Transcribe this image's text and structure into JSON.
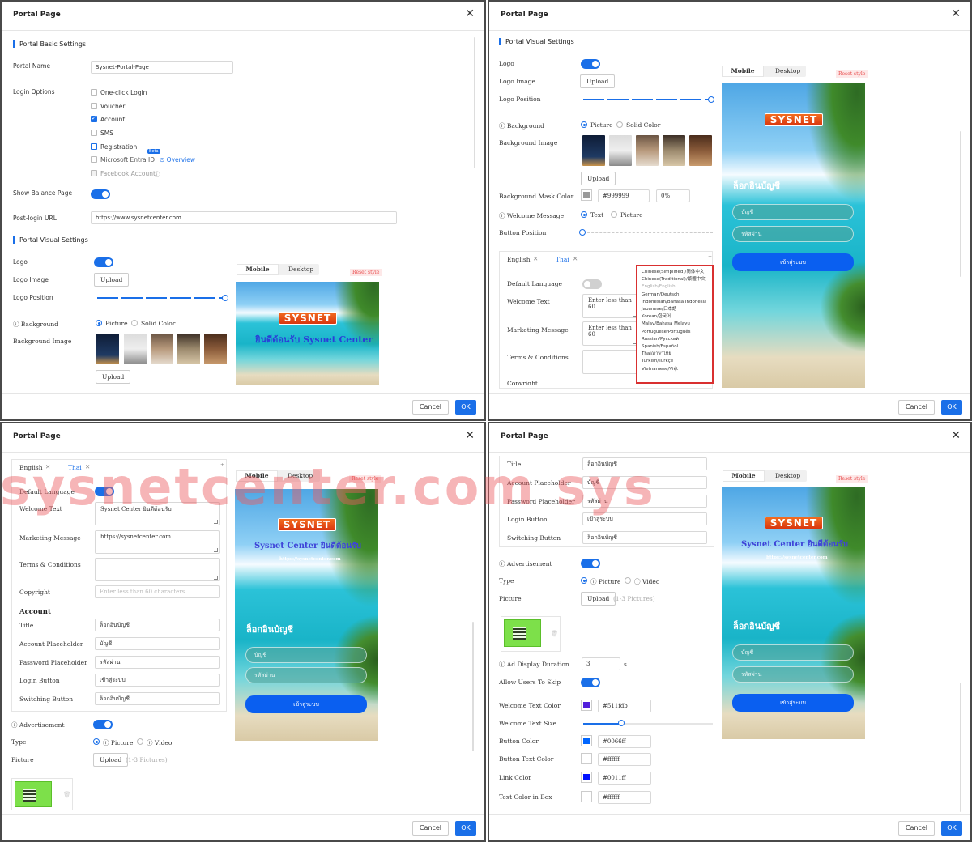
{
  "dialog_title": "Portal Page",
  "close_glyph": "✕",
  "cancel": "Cancel",
  "ok": "OK",
  "basic": {
    "section": "Portal Basic Settings",
    "portal_name_label": "Portal Name",
    "portal_name_value": "Sysnet-Portal-Page",
    "login_options_label": "Login Options",
    "options": [
      "One-click Login",
      "Voucher",
      "Account",
      "SMS",
      "Registration",
      "Microsoft Entra ID",
      "Facebook Account"
    ],
    "beta": "Beta",
    "overview": "Overview",
    "show_balance_label": "Show Balance Page",
    "post_login_label": "Post-login URL",
    "post_login_value": "https://www.sysnetcenter.com"
  },
  "visual": {
    "section": "Portal Visual Settings",
    "logo": "Logo",
    "logo_image": "Logo Image",
    "logo_position": "Logo Position",
    "background": "Background",
    "picture": "Picture",
    "solid_color": "Solid Color",
    "background_image": "Background Image",
    "upload": "Upload",
    "mask_color_label": "Background Mask Color",
    "mask_color": "#999999",
    "mask_opacity": "0%",
    "welcome_message": "Welcome Message",
    "text": "Text",
    "button_position": "Button Position",
    "mobile": "Mobile",
    "desktop": "Desktop",
    "reset_style": "Reset style"
  },
  "preview": {
    "logo": "SYSNET",
    "welcome_p1": "ยินดีต้อนรับ Sysnet Center",
    "welcome_p3": "Sysnet Center ยินดีต้อนรับ",
    "url": "https://sysnetcenter.com",
    "title": "ล็อกอินบัญชี",
    "account": "บัญชี",
    "password": "รหัสผ่าน",
    "login": "เข้าสู่ระบบ"
  },
  "lang": {
    "english": "English",
    "thai": "Thai",
    "default_language": "Default Language",
    "welcome_text": "Welcome Text",
    "marketing": "Marketing Message",
    "terms": "Terms & Conditions",
    "copyright": "Copyright",
    "placeholder": "Enter less than 60 characters.",
    "placeholder_short": "Enter less than 60",
    "dropdown": [
      "Chinese(Simplified)/简体中文",
      "Chinese(Traditional)/繁體中文",
      "English/English",
      "German/Deutsch",
      "Indonesian/Bahasa Indonesia",
      "Japanese/日本語",
      "Korean/한국어",
      "Malay/Bahasa Melayu",
      "Portuguese/Português",
      "Russian/Русский",
      "Spanish/Español",
      "Thai/ภาษาไทย",
      "Turkish/Türkçe",
      "Vietnamese/Việt"
    ],
    "welcome_value": "Sysnet Center ยินดีต้อนรับ",
    "marketing_value": "https://sysnetcenter.com"
  },
  "account": {
    "heading": "Account",
    "title": "Title",
    "account_ph": "Account Placeholder",
    "password_ph": "Password Placeholder",
    "login_button": "Login Button",
    "switching_button": "Switching Button",
    "title_value": "ล็อกอินบัญชี",
    "account_value": "บัญชี",
    "password_value": "รหัสผ่าน",
    "login_value": "เข้าสู่ระบบ",
    "switching_value": "ล็อกอินบัญชี"
  },
  "ads": {
    "advertisement": "Advertisement",
    "type": "Type",
    "picture": "Picture",
    "video": "Video",
    "pictures_hint": "(1-3 Pictures)",
    "duration_label": "Ad Display Duration",
    "duration_value": "3",
    "duration_unit": "s",
    "allow_skip": "Allow Users To Skip"
  },
  "colors": {
    "welcome_text_color": "Welcome Text Color",
    "welcome_text_color_value": "#511fdb",
    "welcome_text_size": "Welcome Text Size",
    "button_color": "Button Color",
    "button_color_value": "#0066ff",
    "button_text_color": "Button Text Color",
    "button_text_color_value": "#ffffff",
    "link_color": "Link Color",
    "link_color_value": "#0011ff",
    "text_color_box": "Text Color in Box",
    "text_color_box_value": "#ffffff"
  },
  "watermark": "sysnetcenter.com sys",
  "icons": [
    "close-icon",
    "help-icon",
    "radio-icon",
    "checkbox-icon",
    "delete-icon"
  ]
}
